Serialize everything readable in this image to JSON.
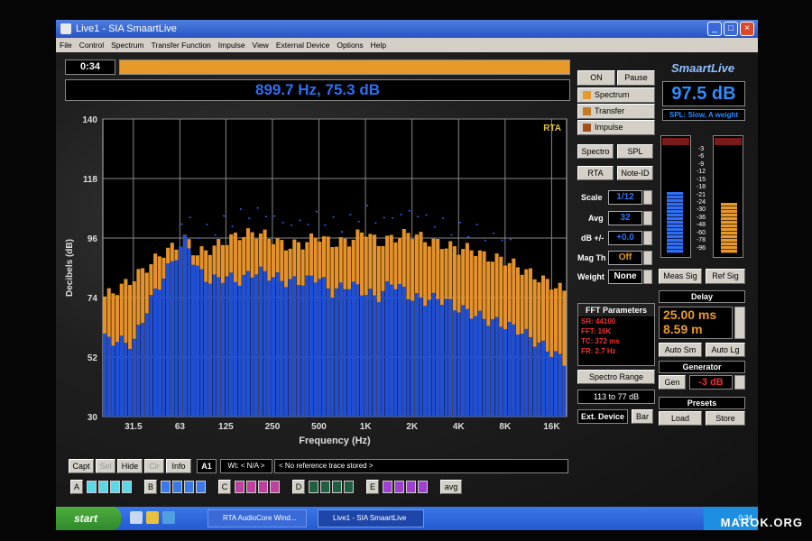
{
  "window": {
    "title": "Live1 - SIA SmaartLive"
  },
  "menu": [
    "File",
    "Control",
    "Spectrum",
    "Transfer Function",
    "Impulse",
    "View",
    "External Device",
    "Options",
    "Help"
  ],
  "topbar": {
    "time": "0:34",
    "capture_progress": 1.0,
    "cursor_readout": "899.7 Hz, 75.3 dB"
  },
  "chart_data": {
    "type": "bar",
    "title": "",
    "mode_label": "RTA",
    "xlabel": "Frequency (Hz)",
    "ylabel": "Decibels (dB)",
    "ylim": [
      30,
      140
    ],
    "y_ticks": [
      "140",
      "118",
      "96",
      "74",
      "52",
      "30"
    ],
    "x_ticks": [
      "31.5",
      "63",
      "125",
      "250",
      "500",
      "1K",
      "2K",
      "4K",
      "8K",
      "16K"
    ],
    "log_x": true,
    "grid": true,
    "series": [
      {
        "points": [
          [
            20,
            74
          ],
          [
            25,
            77
          ],
          [
            31.5,
            81
          ],
          [
            40,
            86
          ],
          [
            50,
            91
          ],
          [
            60,
            93
          ],
          [
            70,
            96
          ],
          [
            80,
            90
          ],
          [
            100,
            92
          ],
          [
            125,
            95
          ],
          [
            150,
            97
          ],
          [
            200,
            98
          ],
          [
            250,
            96
          ],
          [
            300,
            93
          ],
          [
            400,
            94
          ],
          [
            500,
            97
          ],
          [
            600,
            94
          ],
          [
            800,
            95
          ],
          [
            1000,
            99
          ],
          [
            1200,
            94
          ],
          [
            1500,
            96
          ],
          [
            2000,
            98
          ],
          [
            2500,
            95
          ],
          [
            3000,
            94
          ],
          [
            4000,
            92
          ],
          [
            5000,
            92
          ],
          [
            6000,
            89
          ],
          [
            8000,
            88
          ],
          [
            10000,
            85
          ],
          [
            12500,
            82
          ],
          [
            16000,
            79
          ],
          [
            20000,
            76
          ]
        ]
      },
      {
        "points": [
          [
            20,
            59
          ],
          [
            25,
            58
          ],
          [
            31.5,
            57
          ],
          [
            40,
            72
          ],
          [
            50,
            82
          ],
          [
            60,
            90
          ],
          [
            70,
            96
          ],
          [
            80,
            85
          ],
          [
            100,
            80
          ],
          [
            125,
            82
          ],
          [
            150,
            80
          ],
          [
            200,
            84
          ],
          [
            250,
            82
          ],
          [
            300,
            80
          ],
          [
            400,
            80
          ],
          [
            500,
            82
          ],
          [
            600,
            76
          ],
          [
            800,
            79
          ],
          [
            1000,
            76
          ],
          [
            1200,
            74
          ],
          [
            1500,
            80
          ],
          [
            2000,
            74
          ],
          [
            2500,
            73
          ],
          [
            3000,
            74
          ],
          [
            4000,
            70
          ],
          [
            5000,
            68
          ],
          [
            6000,
            66
          ],
          [
            8000,
            64
          ],
          [
            10000,
            62
          ],
          [
            12500,
            58
          ],
          [
            16000,
            54
          ],
          [
            20000,
            50
          ]
        ]
      }
    ],
    "colors": {
      "series_1": "#e5922a",
      "series_2": "#1e4fd8",
      "peaks": "#2a62ff"
    }
  },
  "control": {
    "on": "ON",
    "pause": "Pause"
  },
  "modes": [
    {
      "label": "Spectrum",
      "color": "#e79a2a"
    },
    {
      "label": "Transfer",
      "color": "#c47a20"
    },
    {
      "label": "Impulse",
      "color": "#a0521a"
    }
  ],
  "views": {
    "spectro": "Spectro",
    "spl": "SPL",
    "rta": "RTA",
    "note_id": "Note-ID"
  },
  "settings": {
    "scale_label": "Scale",
    "scale_value": "1/12",
    "avg_label": "Avg",
    "avg_value": "32",
    "db_label": "dB +/-",
    "db_value": "+0.0",
    "magth_label": "Mag Th",
    "magth_value": "Off",
    "weight_label": "Weight",
    "weight_value": "None"
  },
  "fft": {
    "title": "FFT Parameters",
    "lines": [
      "SR: 44100",
      "FFT: 16K",
      "TC: 372 ms",
      "FR: 2.7 Hz"
    ]
  },
  "spectro_range": {
    "title": "Spectro Range",
    "value": "113 to 77 dB"
  },
  "ext_device": "Ext. Device",
  "bar": "Bar",
  "logo": "SmaartLive",
  "spl": {
    "value": "97.5 dB",
    "mode": "SPL: Slow, A weight"
  },
  "meter": {
    "scale": [
      "-3",
      "-6",
      "-9",
      "-12",
      "-15",
      "-18",
      "-21",
      "-24",
      "-30",
      "-36",
      "-48",
      "-60",
      "-78",
      "-96"
    ],
    "left_level": 0.55,
    "right_level": 0.45
  },
  "meas_sig": "Meas Sig",
  "ref_sig": "Ref Sig",
  "delay": {
    "title": "Delay",
    "ms": "25.00 ms",
    "m": "8.59 m",
    "auto_sm": "Auto Sm",
    "auto_lg": "Auto Lg"
  },
  "generator": {
    "title": "Generator",
    "gen": "Gen",
    "level": "-3 dB"
  },
  "presets": {
    "title": "Presets",
    "load": "Load",
    "store": "Store"
  },
  "bottom": {
    "capt": "Capt",
    "sel": "Sel",
    "hide": "Hide",
    "clr": "Clr",
    "info": "Info",
    "slot": "A1",
    "wt": "Wt: < N/A >",
    "ref_msg": "< No reference trace stored >",
    "banks": [
      "A",
      "B",
      "C",
      "D",
      "E"
    ],
    "avg": "avg"
  },
  "taskbar": {
    "start": "start",
    "task1": "RTA AudioCore Wind...",
    "task2": "Live1 - SIA SmaartLive",
    "clock": "0:34"
  },
  "watermark": "MAROK.ORG"
}
